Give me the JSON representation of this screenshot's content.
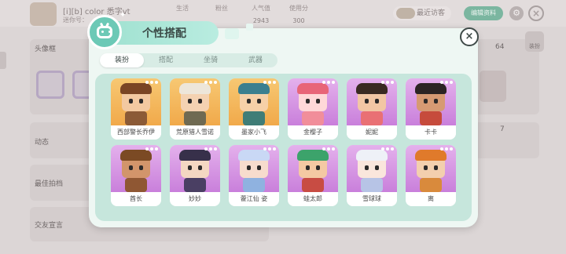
{
  "background": {
    "player_name": "[i][b] color 悉字vt",
    "player_id": "迷你号：",
    "stats": [
      {
        "label": "生活",
        "value": ""
      },
      {
        "label": "粉丝",
        "value": ""
      },
      {
        "label": "人气值",
        "value": "2943"
      },
      {
        "label": "使用分",
        "value": "300"
      }
    ],
    "visitor_label": "最近访客",
    "green_button": "编辑资料",
    "sections": [
      {
        "label": "头像框",
        "count": "64"
      },
      {
        "label": "动态",
        "count": "7"
      },
      {
        "label": "最佳拍档",
        "count": ""
      },
      {
        "label": "交友宣言",
        "count": ""
      }
    ],
    "right_icon_label": "装扮"
  },
  "modal": {
    "title": "个性搭配",
    "tabs": [
      {
        "label": "装扮",
        "active": true
      },
      {
        "label": "搭配",
        "active": false
      },
      {
        "label": "坐骑",
        "active": false
      },
      {
        "label": "武器",
        "active": false
      }
    ],
    "close_label": "×",
    "skins": [
      {
        "name": "西部警长乔伊",
        "bg": "#f7c873",
        "bg2": "#f1a94a",
        "skin": "#f3c9a1",
        "hair": "#7a4524",
        "body": "#8b5a36"
      },
      {
        "name": "荒原猎人雪诺",
        "bg": "#f7c873",
        "bg2": "#f1a94a",
        "skin": "#f4d2b2",
        "hair": "#ede6da",
        "body": "#6f6a52"
      },
      {
        "name": "墨家小飞",
        "bg": "#f7c873",
        "bg2": "#f1a94a",
        "skin": "#f6d0a8",
        "hair": "#3b7f8f",
        "body": "#3f7d77"
      },
      {
        "name": "金樱子",
        "bg": "#e4b1ec",
        "bg2": "#c97fdb",
        "skin": "#ffd8d8",
        "hair": "#e86578",
        "body": "#f18e9a"
      },
      {
        "name": "妮妮",
        "bg": "#e4b1ec",
        "bg2": "#c97fdb",
        "skin": "#f2c6a4",
        "hair": "#3a2a22",
        "body": "#e97074"
      },
      {
        "name": "卡卡",
        "bg": "#e4b1ec",
        "bg2": "#c97fdb",
        "skin": "#d69a73",
        "hair": "#2c2424",
        "body": "#c64b3c"
      },
      {
        "name": "酋长",
        "bg": "#e4b1ec",
        "bg2": "#c97fdb",
        "skin": "#d2956b",
        "hair": "#7b4a24",
        "body": "#8f5733"
      },
      {
        "name": "妙妙",
        "bg": "#e4b1ec",
        "bg2": "#c97fdb",
        "skin": "#f4d7c2",
        "hair": "#37304a",
        "body": "#4a3f63"
      },
      {
        "name": "藿江仙 姿",
        "bg": "#e4b1ec",
        "bg2": "#c97fdb",
        "skin": "#f7dccd",
        "hair": "#c9d8f5",
        "body": "#8fb2e0"
      },
      {
        "name": "蛙太郎",
        "bg": "#e4b1ec",
        "bg2": "#c97fdb",
        "skin": "#f4c9a3",
        "hair": "#3ca36b",
        "body": "#c84c43"
      },
      {
        "name": "雪球球",
        "bg": "#e4b1ec",
        "bg2": "#c97fdb",
        "skin": "#fae6dc",
        "hair": "#eef1f7",
        "body": "#b7c4e6"
      },
      {
        "name": "离",
        "bg": "#e4b1ec",
        "bg2": "#c97fdb",
        "skin": "#f3cfae",
        "hair": "#e07a2b",
        "body": "#d98a3c"
      }
    ]
  },
  "colors": {
    "accent": "#6cc9b6",
    "modal_bg": "#eef7f3",
    "modal_inner": "#c6e6dc"
  }
}
